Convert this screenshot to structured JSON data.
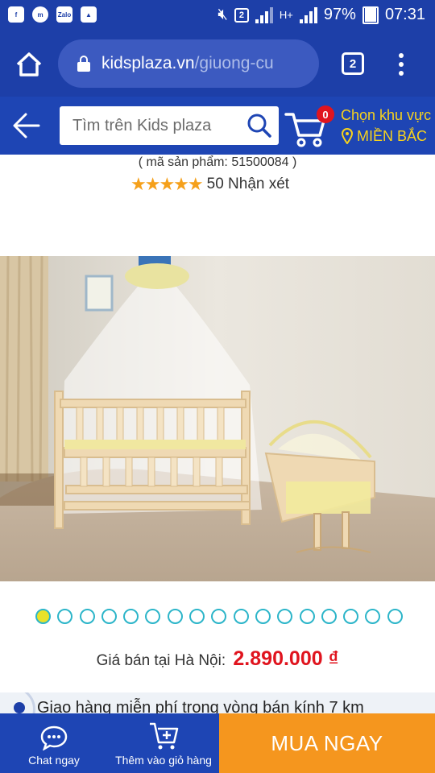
{
  "status_bar": {
    "sim_badge": "2",
    "network": "H+",
    "battery": "97%",
    "time": "07:31",
    "left_icons": [
      "facebook-icon",
      "messenger-icon",
      "zalo-icon",
      "image-icon"
    ]
  },
  "browser": {
    "url_domain": "kidsplaza.vn",
    "url_path": "/giuong-cu",
    "tab_count": "2"
  },
  "site_header": {
    "search_placeholder": "Tìm trên Kids plaza",
    "cart_count": "0",
    "region_label": "Chọn khu vực",
    "region_value": "MIỀN BẮC"
  },
  "product": {
    "code_text": "( mã sản phẩm: 51500084 )",
    "stars": "★★★★★",
    "rating_value": 5,
    "reviews": "50 Nhận xét",
    "image_count": 17,
    "active_image": 1,
    "price_label": "Giá bán tại Hà Nội:",
    "price": "2.890.000 ₫",
    "shipping_note": "Giao hàng miễn phí trong vòng bán kính 7 km"
  },
  "bottom_bar": {
    "chat_label": "Chat ngay",
    "add_cart_label": "Thêm vào giỏ hàng",
    "buy_label": "MUA NGAY"
  },
  "colors": {
    "header_blue": "#1e45b4",
    "accent_yellow": "#f7d21d",
    "price_red": "#e0141e",
    "buy_orange": "#f5961e"
  }
}
